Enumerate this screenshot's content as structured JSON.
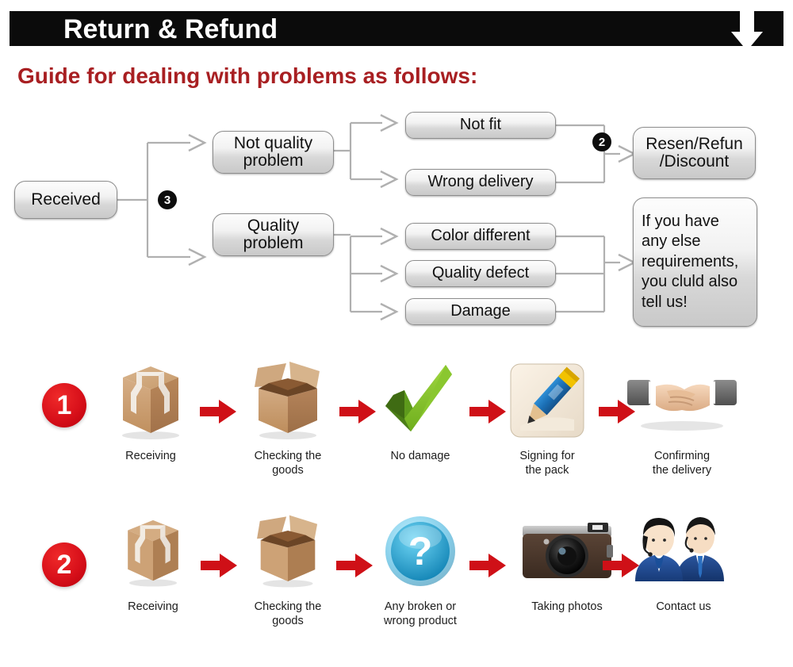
{
  "header": {
    "title": "Return & Refund",
    "arrow_icon": "down-arrow-icon",
    "bar_color": "#0b0b0b"
  },
  "guide": {
    "title": "Guide for dealing with problems as follows:",
    "color": "#A81F22"
  },
  "flowchart": {
    "nodes": {
      "received": "Received",
      "not_quality_problem": "Not quality\nproblem",
      "quality_problem": "Quality\nproblem",
      "not_fit": "Not fit",
      "wrong_delivery": "Wrong delivery",
      "color_different": "Color different",
      "quality_defect": "Quality defect",
      "damage": "Damage",
      "resend_refund_discount": "Resen/Refun\n/Discount",
      "any_else_requirements": "If you have any else requirements, you cluld also tell us!"
    },
    "badges": {
      "branch_three": "3",
      "branch_two": "2"
    }
  },
  "process_rows": [
    {
      "number": "1",
      "steps": [
        {
          "icon": "closed-box-icon",
          "label": "Receiving"
        },
        {
          "icon": "open-box-icon",
          "label": "Checking the goods"
        },
        {
          "icon": "green-check-icon",
          "label": "No damage"
        },
        {
          "icon": "pencil-sign-icon",
          "label": "Signing for the pack"
        },
        {
          "icon": "handshake-icon",
          "label": "Confirming the delivery"
        }
      ]
    },
    {
      "number": "2",
      "steps": [
        {
          "icon": "closed-box-icon",
          "label": "Receiving"
        },
        {
          "icon": "open-box-icon",
          "label": "Checking the goods"
        },
        {
          "icon": "question-mark-icon",
          "label": "Any broken or wrong product"
        },
        {
          "icon": "camera-icon",
          "label": "Taking photos"
        },
        {
          "icon": "support-agents-icon",
          "label": "Contact us"
        }
      ]
    }
  ],
  "colors": {
    "red_arrow": "#CF1017",
    "red_circle": "#D8101A",
    "title_red": "#A81F22",
    "node_border": "#8d8d8d",
    "connector": "#a9a9a9"
  }
}
